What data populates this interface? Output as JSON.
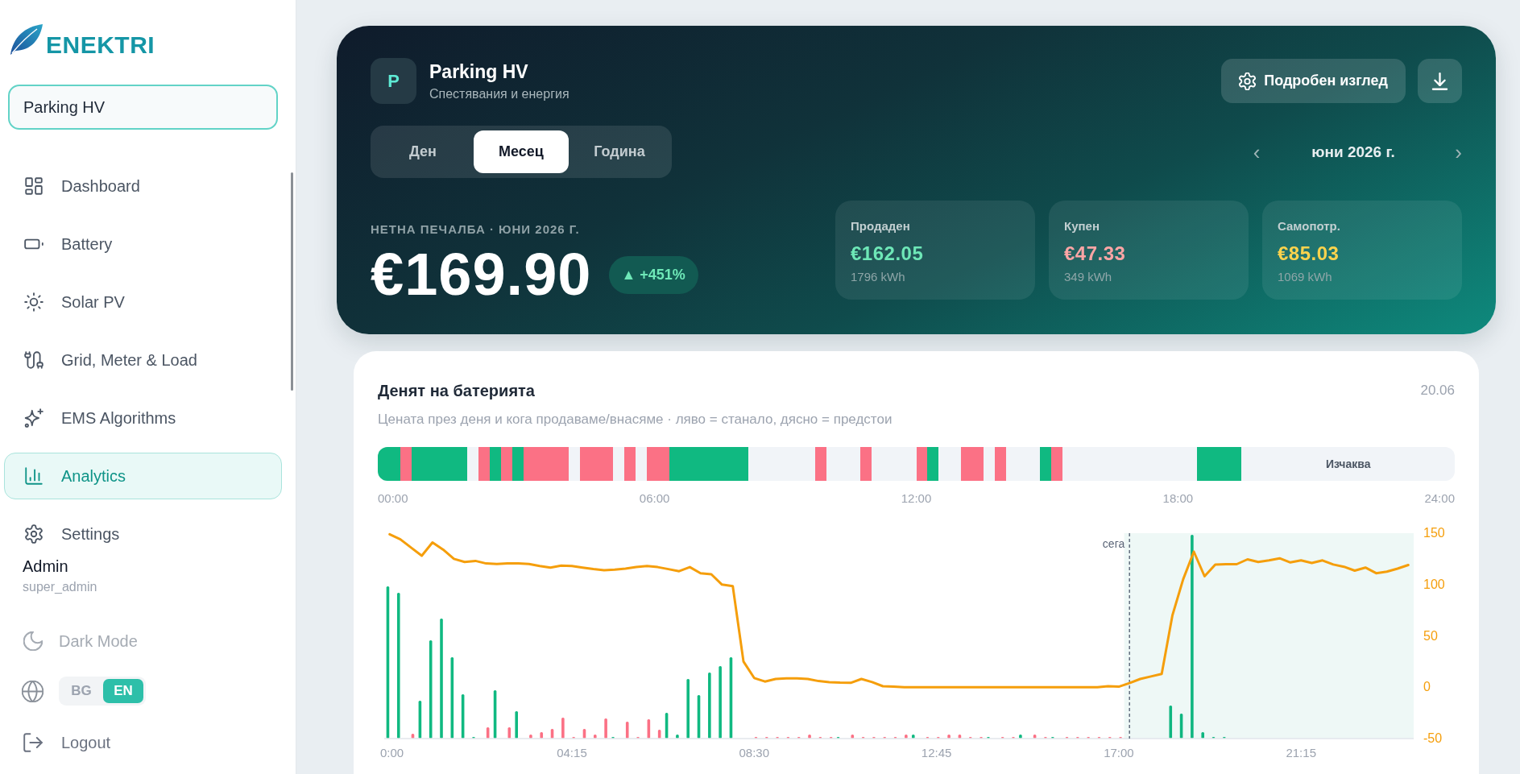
{
  "sidebar": {
    "logo": "ENEKTRI",
    "site_field": {
      "value": "Parking HV"
    },
    "nav": [
      {
        "label": "Dashboard",
        "selected": false
      },
      {
        "label": "Battery",
        "selected": false
      },
      {
        "label": "Solar PV",
        "selected": false
      },
      {
        "label": "Grid, Meter & Load",
        "selected": false
      },
      {
        "label": "EMS Algorithms",
        "selected": false
      },
      {
        "label": "Analytics",
        "selected": true
      },
      {
        "label": "Settings",
        "selected": false
      }
    ],
    "user": {
      "name": "Admin",
      "role": "super_admin"
    },
    "dark_mode": {
      "label": "Dark Mode"
    },
    "languages": [
      {
        "label": "BG",
        "selected": false
      },
      {
        "label": "EN",
        "selected": true
      }
    ],
    "logout": {
      "label": "Logout"
    }
  },
  "header": {
    "avatar": "P",
    "title": "Parking HV",
    "subtitle": "Спестявания и енергия",
    "detail_button": {
      "label": "Подробен изглед"
    },
    "period_tabs": [
      {
        "label": "Ден",
        "selected": false
      },
      {
        "label": "Месец",
        "selected": true
      },
      {
        "label": "Година",
        "selected": false
      }
    ],
    "period_nav": {
      "previous": "‹",
      "label": "юни 2026 г.",
      "next": "›"
    },
    "net_profit": {
      "label": "НЕТНА ПЕЧАЛБА · ЮНИ 2026 Г.",
      "value": "€169.90",
      "change": "▲ +451%"
    },
    "stats": [
      {
        "label": "Продаден",
        "value": "€162.05",
        "energy": "1796 kWh",
        "color": "#6ee7b7"
      },
      {
        "label": "Купен",
        "value": "€47.33",
        "energy": "349 kWh",
        "color": "#fca5a5"
      },
      {
        "label": "Самопотр.",
        "value": "€85.03",
        "energy": "1069 kWh",
        "color": "#fcd34d"
      }
    ]
  },
  "battery_day": {
    "title": "Денят на батерията",
    "date": "20.06",
    "subtitle": "Цената през деня и кога продаваме/внасяме · ляво = станало, дясно = предстои",
    "schedule": {
      "slots": [
        {
          "kind": "sell"
        },
        {
          "kind": "sell"
        },
        {
          "kind": "buy"
        },
        {
          "kind": "sell"
        },
        {
          "kind": "sell"
        },
        {
          "kind": "sell"
        },
        {
          "kind": "sell"
        },
        {
          "kind": "sell"
        },
        {
          "kind": "idle"
        },
        {
          "kind": "buy"
        },
        {
          "kind": "sell"
        },
        {
          "kind": "buy"
        },
        {
          "kind": "sell"
        },
        {
          "kind": "buy"
        },
        {
          "kind": "buy"
        },
        {
          "kind": "buy"
        },
        {
          "kind": "buy"
        },
        {
          "kind": "idle"
        },
        {
          "kind": "buy"
        },
        {
          "kind": "buy"
        },
        {
          "kind": "buy"
        },
        {
          "kind": "idle"
        },
        {
          "kind": "buy"
        },
        {
          "kind": "idle"
        },
        {
          "kind": "buy"
        },
        {
          "kind": "buy"
        },
        {
          "kind": "sell"
        },
        {
          "kind": "sell"
        },
        {
          "kind": "sell"
        },
        {
          "kind": "sell"
        },
        {
          "kind": "sell"
        },
        {
          "kind": "sell"
        },
        {
          "kind": "sell"
        },
        {
          "kind": "idle"
        },
        {
          "kind": "idle"
        },
        {
          "kind": "idle"
        },
        {
          "kind": "idle"
        },
        {
          "kind": "idle"
        },
        {
          "kind": "idle"
        },
        {
          "kind": "buy"
        },
        {
          "kind": "idle"
        },
        {
          "kind": "idle"
        },
        {
          "kind": "idle"
        },
        {
          "kind": "buy"
        },
        {
          "kind": "idle"
        },
        {
          "kind": "idle"
        },
        {
          "kind": "idle"
        },
        {
          "kind": "idle"
        },
        {
          "kind": "buy"
        },
        {
          "kind": "sell"
        },
        {
          "kind": "idle"
        },
        {
          "kind": "idle"
        },
        {
          "kind": "buy"
        },
        {
          "kind": "buy"
        },
        {
          "kind": "idle"
        },
        {
          "kind": "buy"
        },
        {
          "kind": "idle"
        },
        {
          "kind": "idle"
        },
        {
          "kind": "idle"
        },
        {
          "kind": "sell"
        },
        {
          "kind": "buy"
        },
        {
          "kind": "idle"
        },
        {
          "kind": "idle"
        },
        {
          "kind": "idle"
        },
        {
          "kind": "idle"
        },
        {
          "kind": "idle"
        },
        {
          "kind": "idle"
        },
        {
          "kind": "idle"
        },
        {
          "kind": "idle"
        },
        {
          "kind": "idle"
        },
        {
          "kind": "idle"
        },
        {
          "kind": "idle"
        },
        {
          "kind": "idle"
        },
        {
          "kind": "sell"
        },
        {
          "kind": "sell"
        },
        {
          "kind": "sell"
        },
        {
          "kind": "sell"
        },
        {
          "kind": "idle"
        },
        {
          "kind": "idle"
        },
        {
          "kind": "idle"
        },
        {
          "kind": "idle"
        },
        {
          "kind": "idle"
        },
        {
          "kind": "idle"
        },
        {
          "kind": "idle"
        },
        {
          "kind": "idle"
        },
        {
          "kind": "idle"
        },
        {
          "kind": "idle"
        },
        {
          "kind": "idle"
        },
        {
          "kind": "idle"
        },
        {
          "kind": "idle"
        },
        {
          "kind": "idle"
        },
        {
          "kind": "idle"
        },
        {
          "kind": "idle"
        },
        {
          "kind": "idle"
        },
        {
          "kind": "idle"
        },
        {
          "kind": "idle"
        }
      ],
      "status": "Изчаква",
      "ticks": [
        "00:00",
        "06:00",
        "12:00",
        "18:00",
        "24:00"
      ]
    },
    "chart_data": {
      "type": "line",
      "x": [
        0,
        0.25,
        0.5,
        0.75,
        1,
        1.25,
        1.5,
        1.75,
        2,
        2.25,
        2.5,
        2.75,
        3,
        3.25,
        3.5,
        3.75,
        4,
        4.25,
        4.5,
        4.75,
        5,
        5.25,
        5.5,
        5.75,
        6,
        6.25,
        6.5,
        6.75,
        7,
        7.25,
        7.5,
        7.75,
        8,
        8.25,
        8.5,
        8.75,
        9,
        9.25,
        9.5,
        9.75,
        10,
        10.25,
        10.5,
        10.75,
        11,
        11.25,
        11.5,
        11.75,
        12,
        12.25,
        12.5,
        12.75,
        13,
        13.25,
        13.5,
        13.75,
        14,
        14.25,
        14.5,
        14.75,
        15,
        15.25,
        15.5,
        15.75,
        16,
        16.25,
        16.5,
        16.75,
        17,
        17.25,
        17.5,
        17.75,
        18,
        18.25,
        18.5,
        18.75,
        19,
        19.25,
        19.5,
        19.75,
        20,
        20.25,
        20.5,
        20.75,
        21,
        21.25,
        21.5,
        21.75,
        22,
        22.25,
        22.5,
        22.75,
        23,
        23.25,
        23.5,
        23.75
      ],
      "xlim": [
        -0.125,
        23.875
      ],
      "xticks": [
        {
          "value": 0,
          "label": "0:00"
        },
        {
          "value": 4.25,
          "label": "04:15"
        },
        {
          "value": 8.5,
          "label": "08:30"
        },
        {
          "value": 12.75,
          "label": "12:45"
        },
        {
          "value": 17,
          "label": "17:00"
        },
        {
          "value": 21.25,
          "label": "21:15"
        }
      ],
      "ylim": [
        -50,
        150
      ],
      "yticks": [
        150,
        100,
        50,
        0,
        -50
      ],
      "series": [
        {
          "color": "#f59e0b",
          "values": [
            149,
            144,
            136,
            128,
            141,
            134,
            125,
            122,
            123,
            120.5,
            120,
            120.5,
            120.7,
            120,
            118,
            116.5,
            118.5,
            118,
            116.5,
            115,
            114,
            114.5,
            115.5,
            117,
            118,
            117,
            115,
            113,
            117,
            111,
            110,
            100,
            98.5,
            25,
            9,
            5.5,
            8,
            8.6,
            8.6,
            8,
            6,
            5,
            4.5,
            4.3,
            8,
            5,
            1,
            0.5,
            0,
            0,
            0,
            0,
            0,
            0,
            0,
            0,
            0,
            0,
            0,
            0,
            0,
            0,
            0,
            0,
            0,
            0,
            0,
            1,
            0.5,
            4,
            8,
            10.5,
            13,
            70,
            105,
            132,
            108,
            119.5,
            119.8,
            119.8,
            124.5,
            122,
            123.5,
            125.5,
            121.5,
            123.5,
            121,
            123.5,
            119.5,
            117.3,
            113.5,
            116.5,
            111,
            112.5,
            115.5,
            119
          ]
        }
      ],
      "ref_lines": [
        {
          "axis": "x",
          "value": 17.25,
          "label": "сега"
        }
      ],
      "bands": [
        {
          "axis": "x",
          "from": 17.125,
          "to": 23.875
        }
      ]
    }
  }
}
